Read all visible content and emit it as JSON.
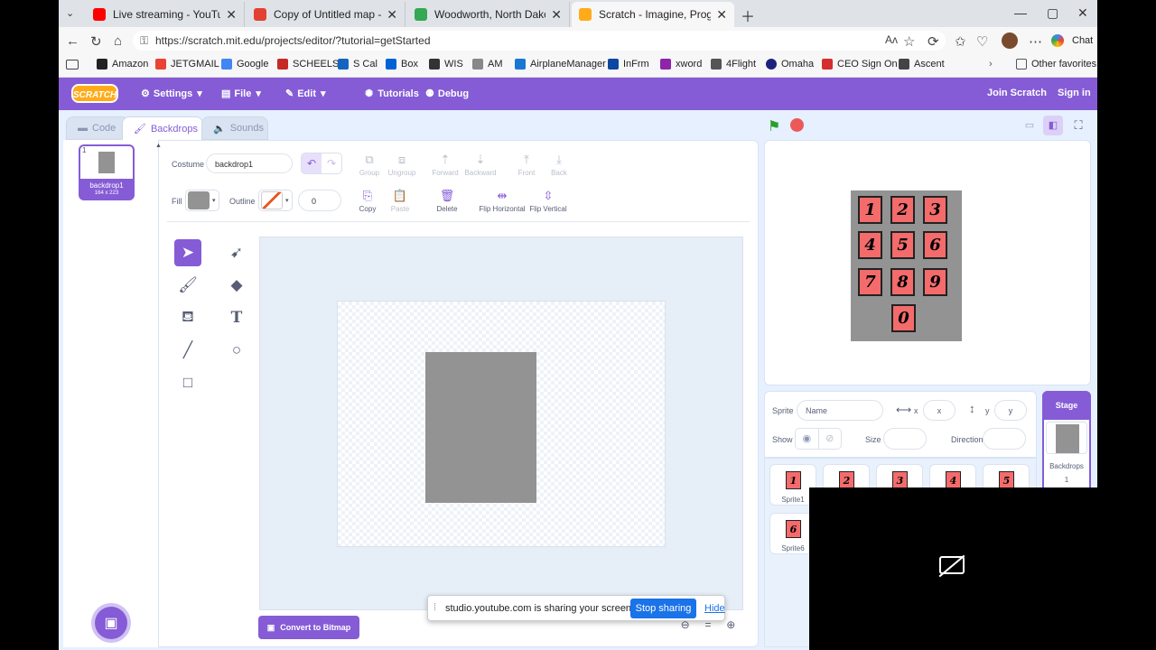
{
  "browser": {
    "tabs": [
      {
        "title": "Live streaming - YouTube Stu",
        "color": "#ff0000",
        "active": false
      },
      {
        "title": "Copy of Untitled map - Google M",
        "color": "#e34133",
        "active": false
      },
      {
        "title": "Woodworth, North Dakota - Goog",
        "color": "#34a853",
        "active": false
      },
      {
        "title": "Scratch - Imagine, Program, Share",
        "color": "#ffab19",
        "active": true
      }
    ],
    "url": "https://scratch.mit.edu/projects/editor/?tutorial=getStarted",
    "chat_label": "Chat",
    "bookmarks": [
      "Amazon",
      "JETGMAIL",
      "Google",
      "SCHEELS",
      "S Cal",
      "Box",
      "WIS",
      "AM",
      "AirplaneManager",
      "InFrm",
      "xword",
      "4Flight",
      "Omaha",
      "CEO Sign On",
      "Ascent"
    ],
    "other_favorites": "Other favorites"
  },
  "menubar": {
    "logo": "SCRATCH",
    "settings": "Settings",
    "file": "File",
    "edit": "Edit",
    "tutorials": "Tutorials",
    "debug": "Debug",
    "join": "Join Scratch",
    "signin": "Sign in"
  },
  "editor_tabs": {
    "code": "Code",
    "backdrops": "Backdrops",
    "sounds": "Sounds"
  },
  "backdrop_list": [
    {
      "index": "1",
      "name": "backdrop1",
      "size": "164 x 223"
    }
  ],
  "paint": {
    "costume_label": "Costume",
    "costume_name": "backdrop1",
    "fill_label": "Fill",
    "outline_label": "Outline",
    "outline_width": "0",
    "fill_color": "#939393",
    "toolbar": {
      "group": "Group",
      "ungroup": "Ungroup",
      "forward": "Forward",
      "backward": "Backward",
      "front": "Front",
      "back": "Back",
      "copy": "Copy",
      "paste": "Paste",
      "delete": "Delete",
      "flip_h": "Flip Horizontal",
      "flip_v": "Flip Vertical"
    },
    "convert": "Convert to Bitmap"
  },
  "share_bar": {
    "text": "studio.youtube.com is sharing your screen.",
    "stop": "Stop sharing",
    "hide": "Hide"
  },
  "stage": {
    "keys": [
      "1",
      "2",
      "3",
      "4",
      "5",
      "6",
      "7",
      "8",
      "9",
      "0"
    ]
  },
  "sprite_info": {
    "sprite_label": "Sprite",
    "name_placeholder": "Name",
    "x_label": "x",
    "x_placeholder": "x",
    "y_label": "y",
    "y_placeholder": "y",
    "show_label": "Show",
    "size_label": "Size",
    "direction_label": "Direction"
  },
  "sprites": [
    {
      "key": "1",
      "name": "Sprite1"
    },
    {
      "key": "2",
      "name": ""
    },
    {
      "key": "3",
      "name": ""
    },
    {
      "key": "4",
      "name": ""
    },
    {
      "key": "5",
      "name": ""
    },
    {
      "key": "6",
      "name": "Sprite6"
    }
  ],
  "stage_panel": {
    "title": "Stage",
    "backdrops_label": "Backdrops",
    "count": "1"
  },
  "colors": {
    "scratch_purple": "#855cd6",
    "key_red": "#f46b6b",
    "share_blue": "#1a73e8"
  }
}
